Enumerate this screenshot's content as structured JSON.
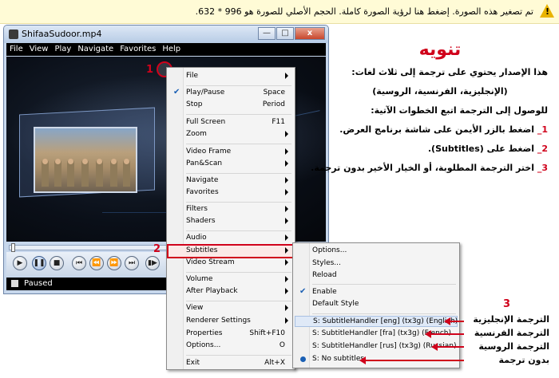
{
  "notice": {
    "icon": "warning-icon",
    "text": "تم تصغير هذه الصورة. إضغط هنا لرؤية الصورة كاملة. الحجم الأصلي للصورة هو 996 * 632."
  },
  "player": {
    "title": "ShifaaSudoor.mp4",
    "window_buttons": {
      "minimize": "—",
      "maximize": "□",
      "close": "x"
    },
    "menu": [
      "File",
      "View",
      "Play",
      "Navigate",
      "Favorites",
      "Help"
    ],
    "status": "Paused"
  },
  "context_menu": {
    "items": [
      {
        "label": "File",
        "submenu": true
      },
      {
        "label": "Play/Pause",
        "shortcut": "Space",
        "checked": true
      },
      {
        "label": "Stop",
        "shortcut": "Period"
      },
      {
        "label": "Full Screen",
        "shortcut": "F11"
      },
      {
        "label": "Zoom",
        "submenu": true
      },
      {
        "label": "Video Frame",
        "submenu": true
      },
      {
        "label": "Pan&Scan",
        "submenu": true
      },
      {
        "label": "Navigate",
        "submenu": true
      },
      {
        "label": "Favorites",
        "submenu": true
      },
      {
        "label": "Filters",
        "submenu": true
      },
      {
        "label": "Shaders",
        "submenu": true
      },
      {
        "label": "Audio",
        "submenu": true
      },
      {
        "label": "Subtitles",
        "submenu": true,
        "highlighted": true
      },
      {
        "label": "Video Stream",
        "submenu": true
      },
      {
        "label": "Volume",
        "submenu": true
      },
      {
        "label": "After Playback",
        "submenu": true
      },
      {
        "label": "View",
        "submenu": true
      },
      {
        "label": "Renderer Settings",
        "submenu": true
      },
      {
        "label": "Properties",
        "shortcut": "Shift+F10"
      },
      {
        "label": "Options...",
        "shortcut": "O"
      },
      {
        "label": "Exit",
        "shortcut": "Alt+X"
      }
    ]
  },
  "subtitles_menu": {
    "items": [
      {
        "label": "Options..."
      },
      {
        "label": "Styles..."
      },
      {
        "label": "Reload"
      },
      {
        "label": "Enable",
        "checked": true
      },
      {
        "label": "Default Style"
      },
      {
        "label": "S: SubtitleHandler [eng] (tx3g) (English)"
      },
      {
        "label": "S: SubtitleHandler [fra] (tx3g) (French)"
      },
      {
        "label": "S: SubtitleHandler [rus] (tx3g) (Russian)"
      },
      {
        "label": "S: No subtitles",
        "selected": true
      }
    ]
  },
  "annotations": {
    "step1": "1",
    "step2": "2",
    "step3": "3"
  },
  "notes": {
    "heading": "تنويه",
    "line1": "هذا الإصدار يحتوي على ترجمة إلى ثلاث لغات:",
    "line2": "(الإنجليزية، الفرنسية، الروسية)",
    "line3": "للوصول إلى الترجمة اتبع الخطوات الآتية:",
    "step1_num": "1_",
    "step1": " اضغط بالزر الأيمن على شاشة برنامج العرض.",
    "step2_num": "2_",
    "step2": " اضغط على (Subtitles).",
    "step3_num": "3_",
    "step3": " اختر الترجمة المطلوبة، أو الخيار الأخير بدون ترجمة."
  },
  "subtitle_labels": {
    "english": "الترجمة الإنجليزية",
    "french": "الترجمة الفرنسية",
    "russian": "الترجمة الروسية",
    "none": "بدون ترجمة"
  },
  "colors": {
    "accent": "#d0021b",
    "notice_bg": "#fffbd6",
    "check": "#1a5fb4"
  }
}
